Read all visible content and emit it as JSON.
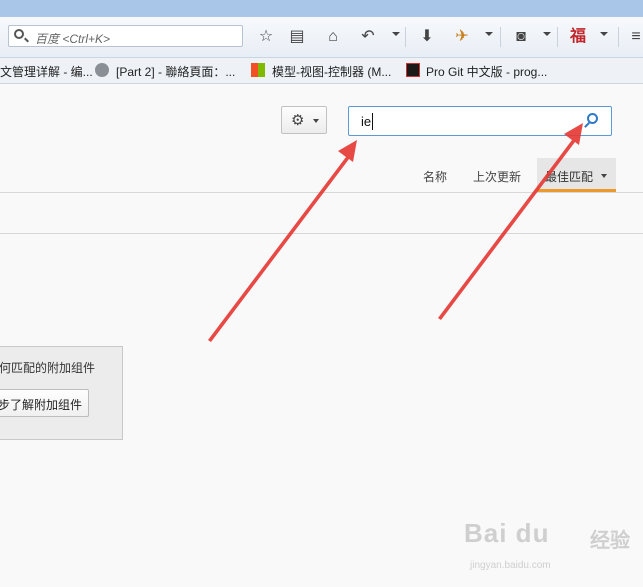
{
  "toolbar": {
    "search_placeholder": "百度 <Ctrl+K>"
  },
  "bookmarks": [
    {
      "label": "文管理详解 - 编..."
    },
    {
      "label": "[Part 2] - 聯絡頁面：..."
    },
    {
      "label": "模型-视图-控制器 (M..."
    },
    {
      "label": "Pro Git 中文版 - prog..."
    }
  ],
  "addons": {
    "search_value": "ie",
    "sort": {
      "name_label": "名称",
      "last_updated_label": "上次更新",
      "best_match_label": "最佳匹配"
    },
    "notice": {
      "message": "何匹配的附加组件",
      "learn_more_label": "步了解附加组件"
    }
  },
  "colors": {
    "accent_orange": "#ed9a2b",
    "search_focus_blue": "#5b9ad7",
    "arrow_red": "#e53935"
  },
  "watermark": {
    "logo": "Bai du",
    "cn": "经验",
    "url": "jingyan.baidu.com"
  }
}
